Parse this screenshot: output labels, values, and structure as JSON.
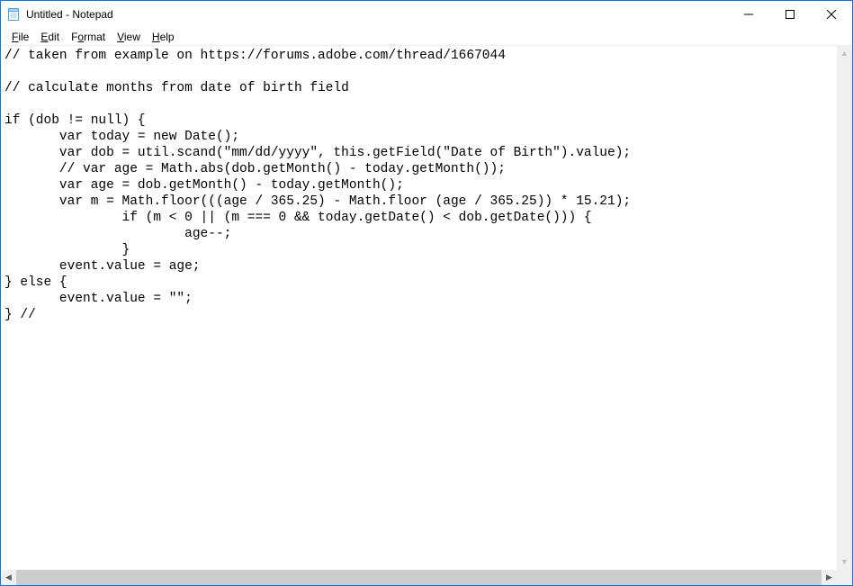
{
  "window": {
    "title": "Untitled - Notepad"
  },
  "menu": {
    "file": "File",
    "edit": "Edit",
    "format": "Format",
    "view": "View",
    "help": "Help"
  },
  "editor": {
    "content": "// taken from example on https://forums.adobe.com/thread/1667044\n\n// calculate months from date of birth field\n\nif (dob != null) {\n       var today = new Date();\n       var dob = util.scand(\"mm/dd/yyyy\", this.getField(\"Date of Birth\").value);\n       // var age = Math.abs(dob.getMonth() - today.getMonth());\n       var age = dob.getMonth() - today.getMonth();\n       var m = Math.floor(((age / 365.25) - Math.floor (age / 365.25)) * 15.21);\n               if (m < 0 || (m === 0 && today.getDate() < dob.getDate())) {\n                       age--;\n               }\n       event.value = age;\n} else {\n       event.value = \"\";\n} //"
  }
}
